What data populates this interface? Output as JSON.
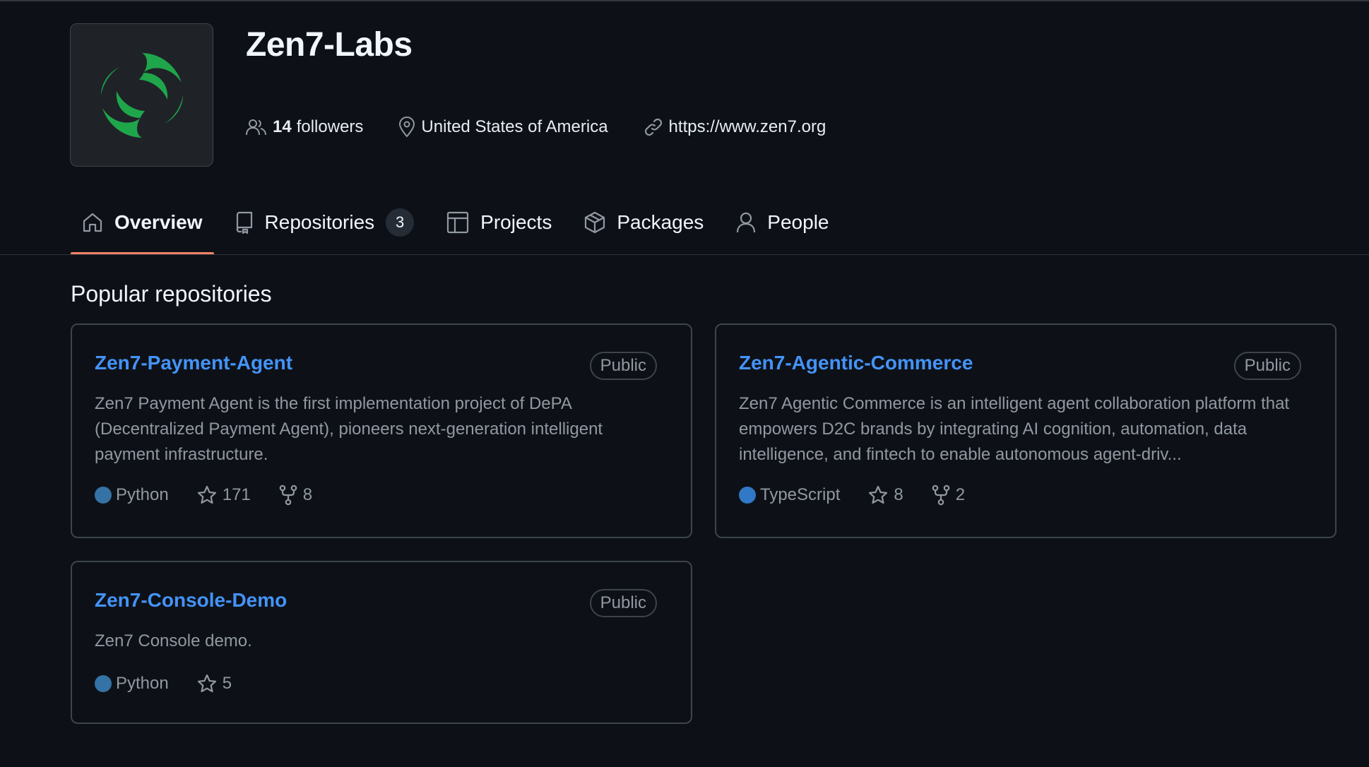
{
  "org": {
    "name": "Zen7-Labs",
    "followers_count": "14",
    "followers_label": "followers",
    "location": "United States of America",
    "website": "https://www.zen7.org"
  },
  "tabs": [
    {
      "label": "Overview",
      "icon": "home-icon",
      "active": true
    },
    {
      "label": "Repositories",
      "icon": "repo-icon",
      "count": "3"
    },
    {
      "label": "Projects",
      "icon": "table-icon"
    },
    {
      "label": "Packages",
      "icon": "package-icon"
    },
    {
      "label": "People",
      "icon": "person-icon"
    }
  ],
  "popular": {
    "title": "Popular repositories",
    "repos": [
      {
        "name": "Zen7-Payment-Agent",
        "visibility": "Public",
        "description": "Zen7 Payment Agent is the first implementation project of DePA (Decentralized Payment Agent), pioneers next-generation intelligent payment infrastructure.",
        "language": "Python",
        "language_color": "#3572A5",
        "stars": "171",
        "forks": "8"
      },
      {
        "name": "Zen7-Agentic-Commerce",
        "visibility": "Public",
        "description": "Zen7 Agentic Commerce is an intelligent agent collaboration platform that empowers D2C brands by integrating AI cognition, automation, data intelligence, and fintech to enable autonomous agent-driv...",
        "language": "TypeScript",
        "language_color": "#3178c6",
        "stars": "8",
        "forks": "2"
      },
      {
        "name": "Zen7-Console-Demo",
        "visibility": "Public",
        "description": "Zen7 Console demo.",
        "language": "Python",
        "language_color": "#3572A5",
        "stars": "5"
      }
    ]
  },
  "colors": {
    "background": "#0d1117",
    "link": "#4493f8",
    "active_tab_underline": "#f78166",
    "logo_green": "#1fa64b"
  }
}
